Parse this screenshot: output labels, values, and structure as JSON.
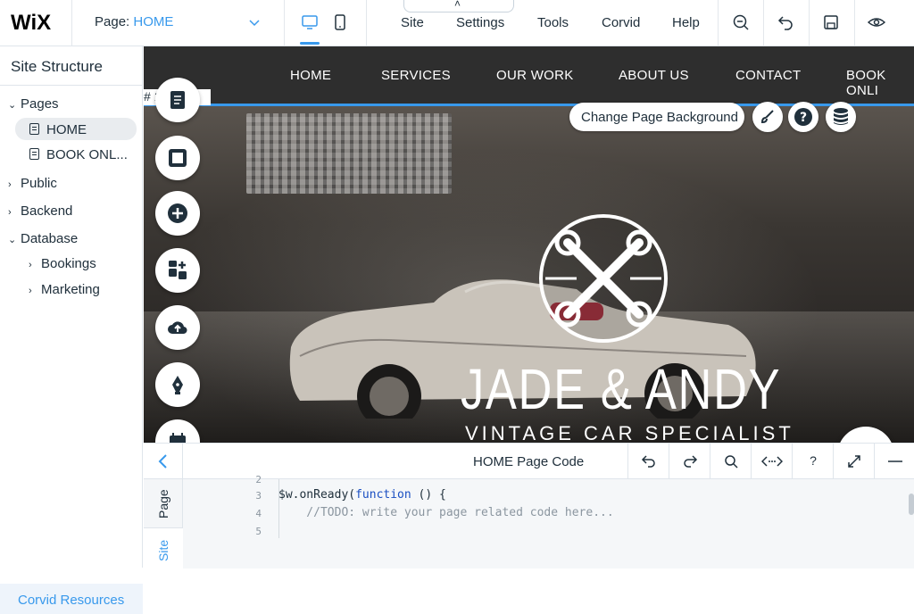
{
  "app": {
    "logo": "WiX"
  },
  "topbar": {
    "page_label": "Page:",
    "page_value": "HOME",
    "menu": [
      "Site",
      "Settings",
      "Tools",
      "Corvid",
      "Help"
    ]
  },
  "sidebar": {
    "title": "Site Structure",
    "items": [
      {
        "label": "Pages",
        "expanded": true
      },
      {
        "label": "HOME",
        "selected": true
      },
      {
        "label": "BOOK ONL..."
      },
      {
        "label": "Public",
        "expanded": false
      },
      {
        "label": "Backend",
        "expanded": false
      },
      {
        "label": "Database",
        "expanded": true
      },
      {
        "label": "Bookings",
        "expanded": false
      },
      {
        "label": "Marketing",
        "expanded": false
      }
    ],
    "resources": "Corvid Resources"
  },
  "site": {
    "nav": [
      "HOME",
      "SERVICES",
      "OUR WORK",
      "ABOUT US",
      "CONTACT",
      "BOOK ONLI"
    ],
    "anchor_tag": "#   1",
    "change_bg": "Change Page Background",
    "brand_title": "JADE & ANDY",
    "brand_sub": "VINTAGE CAR SPECIALIST"
  },
  "code_panel": {
    "title": "HOME Page Code",
    "tabs": [
      "Page",
      "Site"
    ],
    "tool_help": "?",
    "lines": [
      {
        "num": "2",
        "text": ""
      },
      {
        "num": "3",
        "kw_pre": "$w.onReady(",
        "kw": "function",
        "post": " () {"
      },
      {
        "num": "4",
        "comment": "    //TODO: write your page related code here..."
      },
      {
        "num": "5",
        "text": ""
      }
    ]
  },
  "colors": {
    "accent": "#3899ec",
    "text": "#20303c",
    "nav_bg": "#2e2e2e"
  }
}
